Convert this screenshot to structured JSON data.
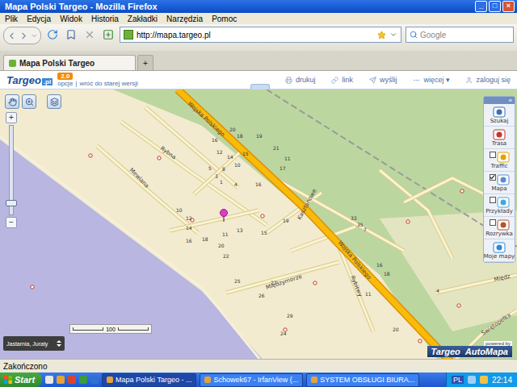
{
  "window": {
    "title": "Mapa Polski Targeo - Mozilla Firefox",
    "controls": [
      "_",
      "□",
      "×"
    ]
  },
  "menu": [
    "Plik",
    "Edycja",
    "Widok",
    "Historia",
    "Zakładki",
    "Narzędzia",
    "Pomoc"
  ],
  "toolbar": {
    "url": "http://mapa.targeo.pl",
    "search_placeholder": "Google"
  },
  "tabs": [
    {
      "label": "Mapa Polski Targeo",
      "selected": true,
      "kind": "page"
    },
    {
      "label": "+",
      "selected": false,
      "kind": "new"
    }
  ],
  "site_header": {
    "logo": "Targeo",
    "logo_suffix": ".pl",
    "version": "2.0",
    "options": "opcje",
    "separator": "|",
    "old_version": "wróć do starej wersji",
    "links": [
      "drukuj",
      "link",
      "wyślij",
      "więcej ▾",
      "zaloguj się"
    ]
  },
  "map": {
    "streets": [
      "Wojska Polskiego",
      "Rybna",
      "Mewiana",
      "Kasztanowe",
      "Wojska Polskiego",
      "Międzymorze",
      "Rybitwy",
      "Świętopełka",
      "Międz"
    ],
    "house_numbers": [
      "20",
      "18",
      "16",
      "19",
      "21",
      "15",
      "17",
      "12",
      "14",
      "10",
      "8",
      "5",
      "3",
      "1",
      "4",
      "16",
      "11",
      "19",
      "10",
      "12",
      "14",
      "16",
      "18",
      "20",
      "22",
      "11",
      "13",
      "15",
      "25",
      "27",
      "26",
      "29",
      "24",
      "33",
      "35",
      "7",
      "16",
      "18",
      "11",
      "20",
      "4"
    ],
    "zoom": {
      "in": "+",
      "out": "−",
      "level": 0.12
    },
    "location": "Jastarnia, Juraty",
    "scale": "100",
    "powered": {
      "by": "powered by",
      "brand": "Targeo",
      "partner": "AutoMapa"
    }
  },
  "tools": {
    "collapse": "«",
    "items": [
      {
        "label": "Szukaj",
        "kind": "button",
        "checked": false
      },
      {
        "label": "Trasa",
        "kind": "button",
        "checked": false
      },
      {
        "label": "Traffic",
        "kind": "toggle",
        "checked": false
      },
      {
        "label": "Mapa",
        "kind": "toggle",
        "checked": true
      },
      {
        "label": "Przykłady",
        "kind": "toggle",
        "checked": false
      },
      {
        "label": "Rozrywka",
        "kind": "toggle",
        "checked": false
      },
      {
        "label": "Moje mapy",
        "kind": "button",
        "checked": false
      }
    ]
  },
  "status_bar": "Zakończono",
  "taskbar": {
    "start": "Start",
    "tasks": [
      {
        "label": "Mapa Polski Targeo - ...",
        "selected": true
      },
      {
        "label": "Schowek67 - IrfanView (...",
        "selected": false
      },
      {
        "label": "SYSTEM OBSŁUGI BIURA...",
        "selected": false
      }
    ],
    "language": "PL",
    "clock": "22:14"
  }
}
